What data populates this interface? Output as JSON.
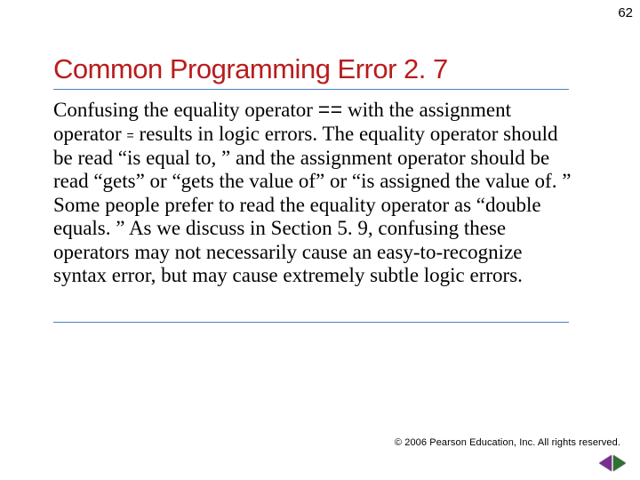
{
  "page_number": "62",
  "title": "Common Programming Error 2. 7",
  "body": {
    "t1": "Confusing the equality operator ",
    "op_eq_eq": "==",
    "t2": " with the assignment operator ",
    "op_eq": "=",
    "t3": " results in logic errors. The equality operator should be read “is equal to, ” and the assignment operator should be read “gets” or “gets the value of” or “is assigned the value of. ” Some people prefer to read the equality operator as “double equals. ” As we discuss in Section 5. 9, confusing these operators may not necessarily cause an easy-to-recognize syntax error, but may cause extremely subtle logic errors."
  },
  "footer": "© 2006 Pearson Education, Inc.  All rights reserved.",
  "colors": {
    "title": "#b91c1c",
    "rule": "#4682c2",
    "prev": "#792f92",
    "next": "#2e7132"
  }
}
